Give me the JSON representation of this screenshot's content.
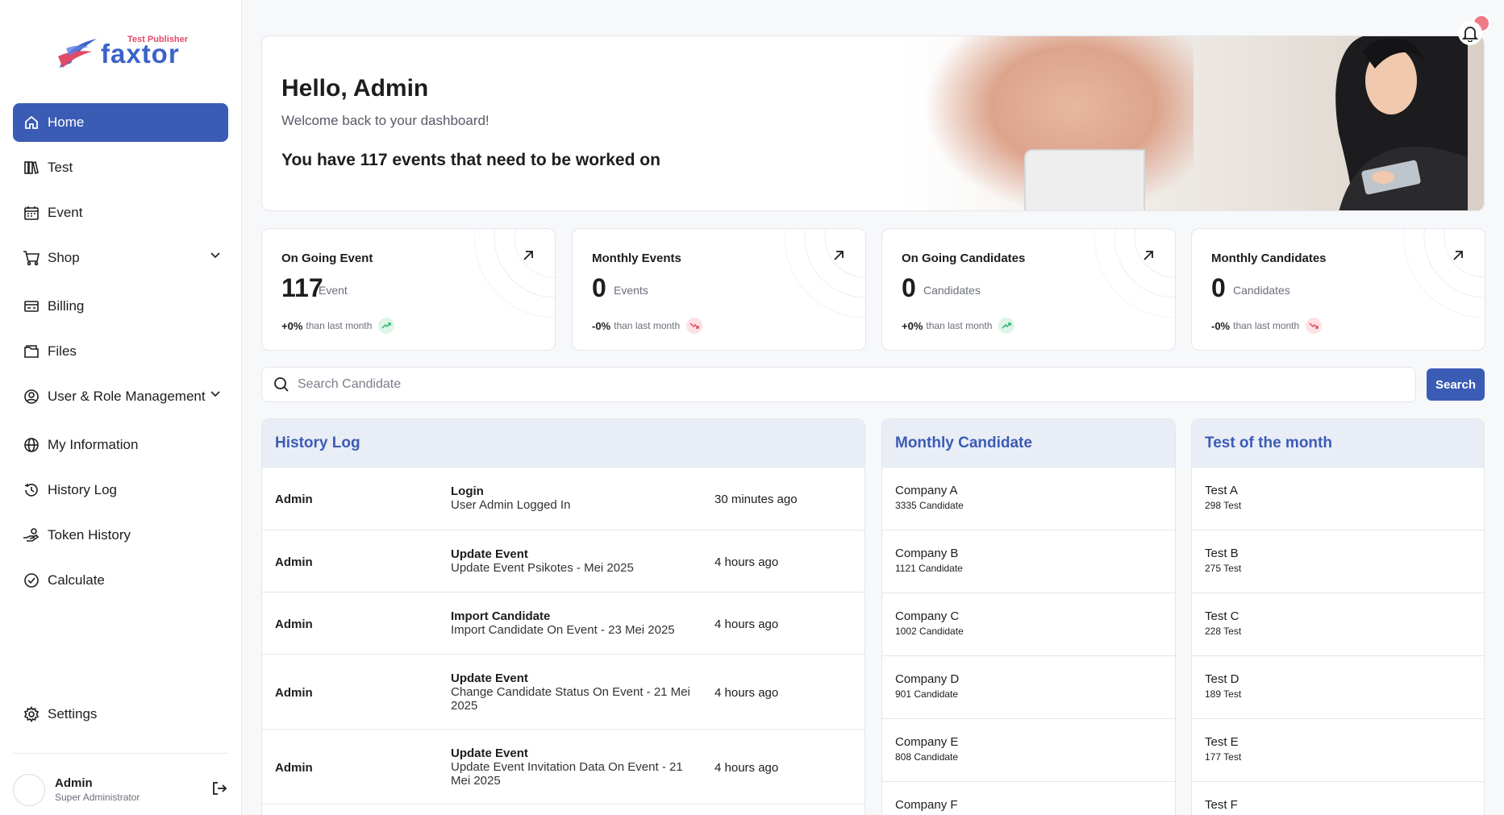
{
  "brand": {
    "tagline": "Test Publisher",
    "name": "faxtor"
  },
  "sidebar": {
    "items": [
      {
        "label": "Home",
        "icon": "home-icon",
        "active": true
      },
      {
        "label": "Test",
        "icon": "books-icon"
      },
      {
        "label": "Event",
        "icon": "calendar-icon"
      },
      {
        "label": "Shop",
        "icon": "cart-icon",
        "expandable": true
      },
      {
        "label": "Billing",
        "icon": "billing-icon"
      },
      {
        "label": "Files",
        "icon": "folder-icon"
      },
      {
        "label": "User & Role Management",
        "icon": "user-circle-icon",
        "expandable": true
      },
      {
        "label": "My Information",
        "icon": "globe-icon"
      },
      {
        "label": "History Log",
        "icon": "history-icon"
      },
      {
        "label": "Token History",
        "icon": "token-hand-icon"
      },
      {
        "label": "Calculate",
        "icon": "check-circle-icon"
      }
    ],
    "settings_label": "Settings",
    "user": {
      "name": "Admin",
      "role": "Super Administrator"
    }
  },
  "hero": {
    "greeting": "Hello, Admin",
    "subtitle": "Welcome back to your dashboard!",
    "message": "You have 117 events that need to be worked on"
  },
  "stats": [
    {
      "label": "On Going Event",
      "value": "117",
      "unit": "Event",
      "change": "+0%",
      "change_text": "than last month",
      "trend": "up"
    },
    {
      "label": "Monthly Events",
      "value": "0",
      "unit": "Events",
      "change": "-0%",
      "change_text": "than last month",
      "trend": "down"
    },
    {
      "label": "On Going Candidates",
      "value": "0",
      "unit": "Candidates",
      "change": "+0%",
      "change_text": "than last month",
      "trend": "up"
    },
    {
      "label": "Monthly Candidates",
      "value": "0",
      "unit": "Candidates",
      "change": "-0%",
      "change_text": "than last month",
      "trend": "down"
    }
  ],
  "search": {
    "placeholder": "Search Candidate",
    "button_label": "Search"
  },
  "history_log": {
    "title": "History Log",
    "rows": [
      {
        "user": "Admin",
        "action": "Login",
        "detail": "User Admin Logged In",
        "time": "30 minutes ago"
      },
      {
        "user": "Admin",
        "action": "Update Event",
        "detail": "Update Event Psikotes - Mei 2025",
        "time": "4 hours ago"
      },
      {
        "user": "Admin",
        "action": "Import Candidate",
        "detail": "Import Candidate On Event - 23 Mei 2025",
        "time": "4 hours ago"
      },
      {
        "user": "Admin",
        "action": "Update Event",
        "detail": "Change Candidate Status On Event - 21 Mei 2025",
        "time": "4 hours ago"
      },
      {
        "user": "Admin",
        "action": "Update Event",
        "detail": "Update Event Invitation Data On Event - 21 Mei 2025",
        "time": "4 hours ago"
      }
    ]
  },
  "monthly_candidate": {
    "title": "Monthly Candidate",
    "rows": [
      {
        "name": "Company A",
        "sub": "3335 Candidate"
      },
      {
        "name": "Company B",
        "sub": "1121 Candidate"
      },
      {
        "name": "Company C",
        "sub": "1002 Candidate"
      },
      {
        "name": "Company D",
        "sub": "901 Candidate"
      },
      {
        "name": "Company E",
        "sub": "808 Candidate"
      },
      {
        "name": "Company F",
        "sub": ""
      }
    ]
  },
  "test_of_month": {
    "title": "Test of the month",
    "rows": [
      {
        "name": "Test A",
        "sub": "298 Test"
      },
      {
        "name": "Test B",
        "sub": "275 Test"
      },
      {
        "name": "Test C",
        "sub": "228 Test"
      },
      {
        "name": "Test D",
        "sub": "189 Test"
      },
      {
        "name": "Test E",
        "sub": "177 Test"
      },
      {
        "name": "Test F",
        "sub": ""
      }
    ]
  },
  "colors": {
    "accent": "#3b5cb5",
    "panel_header_bg": "#e9edf6",
    "trend_up": "#2fb36a",
    "trend_down": "#e5485f",
    "notification_dot": "#f07a86"
  }
}
